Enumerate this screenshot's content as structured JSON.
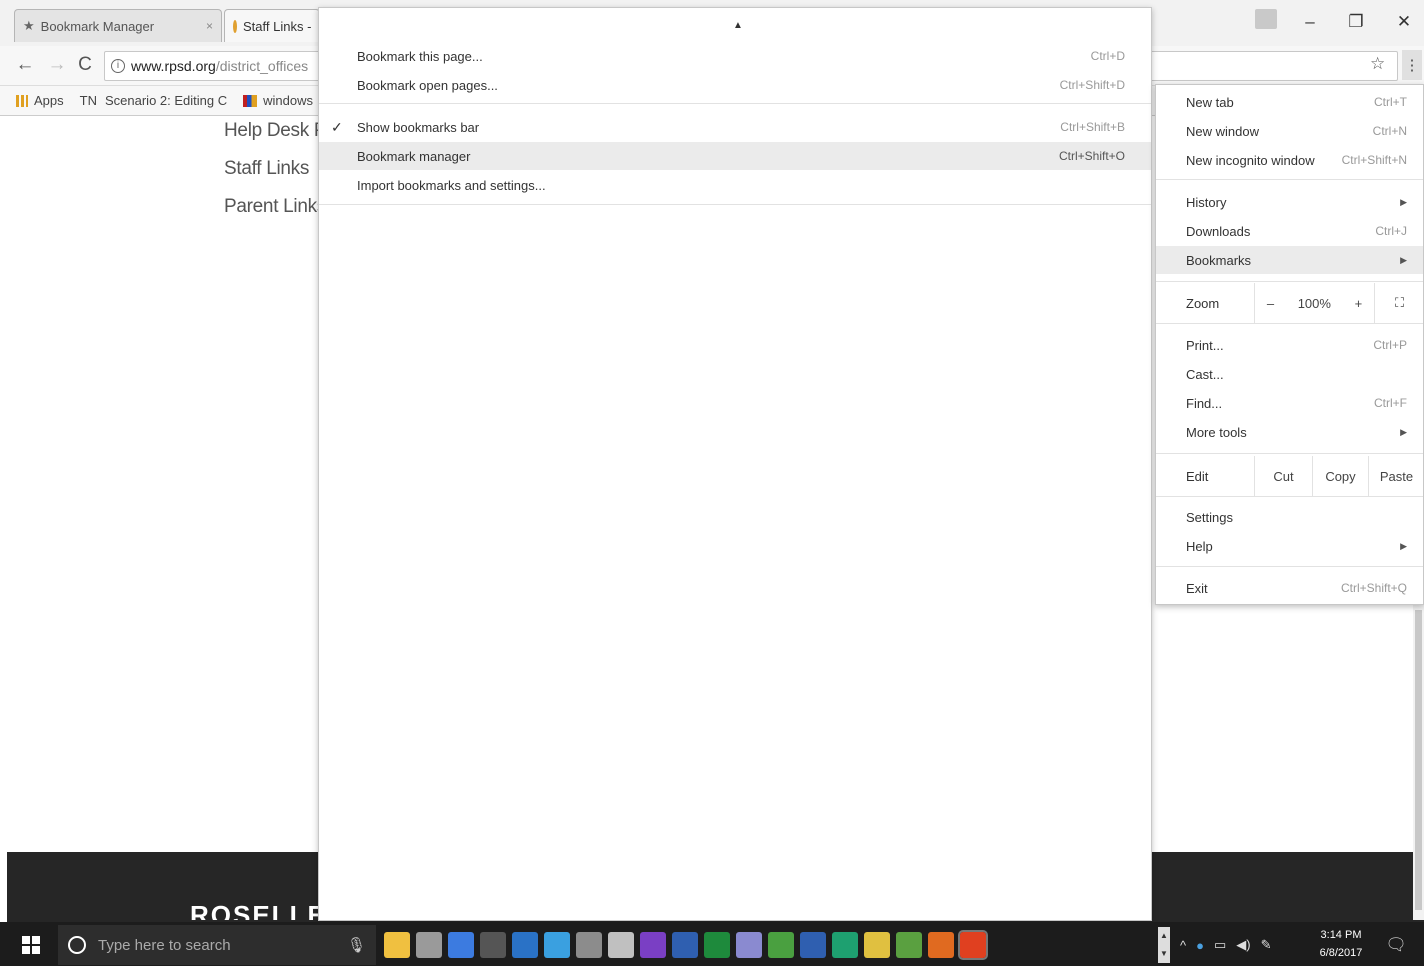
{
  "browser": {
    "tabs": [
      {
        "title": "Bookmark Manager",
        "close": "×"
      },
      {
        "title": "Staff Links -"
      }
    ],
    "window_controls": {
      "minimize": "–",
      "restore": "❐",
      "close": "✕"
    },
    "url_host": "www.rpsd.org",
    "url_path": "/district_offices",
    "bookmarks_bar": {
      "apps": "Apps",
      "items": [
        "TN",
        "Scenario 2: Editing C",
        "windows"
      ]
    }
  },
  "page": {
    "links": [
      "Help Desk P",
      "Staff Links",
      "Parent Links"
    ],
    "footer_brand": "ROSELLE"
  },
  "bookmarks_submenu": {
    "items": [
      {
        "label": "Bookmark this page...",
        "shortcut": "Ctrl+D"
      },
      {
        "label": "Bookmark open pages...",
        "shortcut": "Ctrl+Shift+D"
      },
      {
        "label": "Show bookmarks bar",
        "shortcut": "Ctrl+Shift+B",
        "checked": "✓"
      },
      {
        "label": "Bookmark manager",
        "shortcut": "Ctrl+Shift+O"
      },
      {
        "label": "Import bookmarks and settings..."
      }
    ]
  },
  "main_menu": {
    "new_tab": {
      "label": "New tab",
      "shortcut": "Ctrl+T"
    },
    "new_window": {
      "label": "New window",
      "shortcut": "Ctrl+N"
    },
    "new_incognito": {
      "label": "New incognito window",
      "shortcut": "Ctrl+Shift+N"
    },
    "history": {
      "label": "History"
    },
    "downloads": {
      "label": "Downloads",
      "shortcut": "Ctrl+J"
    },
    "bookmarks": {
      "label": "Bookmarks"
    },
    "zoom": {
      "label": "Zoom",
      "minus": "–",
      "value": "100%",
      "plus": "+"
    },
    "print": {
      "label": "Print...",
      "shortcut": "Ctrl+P"
    },
    "cast": {
      "label": "Cast..."
    },
    "find": {
      "label": "Find...",
      "shortcut": "Ctrl+F"
    },
    "more_tools": {
      "label": "More tools"
    },
    "edit": {
      "label": "Edit",
      "cut": "Cut",
      "copy": "Copy",
      "paste": "Paste"
    },
    "settings": {
      "label": "Settings"
    },
    "help": {
      "label": "Help"
    },
    "exit": {
      "label": "Exit",
      "shortcut": "Ctrl+Shift+Q"
    }
  },
  "taskbar": {
    "search_placeholder": "Type here to search",
    "time": "3:14 PM",
    "date": "6/8/2017",
    "app_icon_colors": [
      "#f0c040",
      "#9a9a9a",
      "#3c7be0",
      "#555555",
      "#2a72c6",
      "#3aa0e0",
      "#8c8c8c",
      "#c0c0c0",
      "#7a3fc4",
      "#2f5fb0",
      "#1e8a3c",
      "#8a8ad0",
      "#4aa040",
      "#2f5fb0",
      "#1ea070",
      "#e0c040",
      "#5aa040",
      "#e06a20",
      "#e04020"
    ]
  }
}
